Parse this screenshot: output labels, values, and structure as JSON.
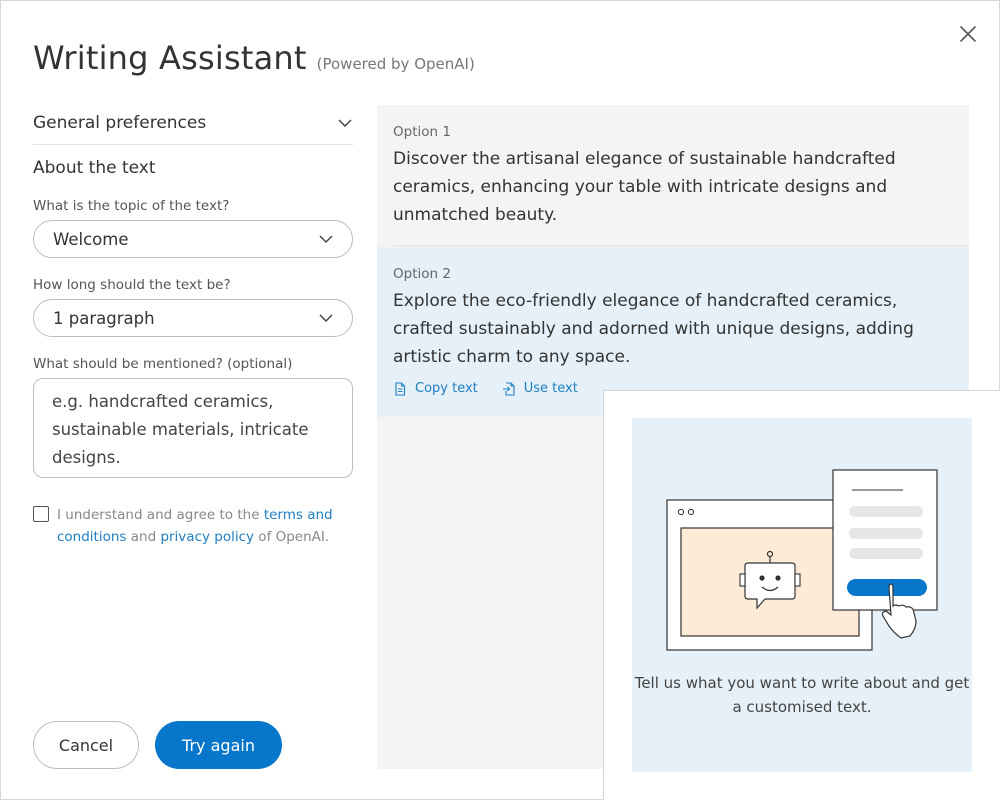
{
  "header": {
    "title": "Writing Assistant",
    "subtitle": "(Powered by OpenAI)"
  },
  "icons": {
    "close": "close-icon",
    "chevron": "chevron-down-icon",
    "copy": "copy-icon",
    "use": "use-text-icon"
  },
  "colors": {
    "accent": "#0877cb",
    "link": "#1e7fc1",
    "highlight": "#e5f0f8",
    "panel": "#f4f4f4"
  },
  "left": {
    "general_preferences": "General preferences",
    "about_title": "About the text",
    "topic_label": "What is the topic of the text?",
    "topic_value": "Welcome",
    "length_label": "How long should the text be?",
    "length_value": "1 paragraph",
    "mention_label": "What should be mentioned? (optional)",
    "mention_value": "e.g. handcrafted ceramics, sustainable materials, intricate designs.",
    "consent": {
      "checked": false,
      "prefix": "I understand and agree to the ",
      "terms": "terms and conditions",
      "middle": " and ",
      "privacy": "privacy policy",
      "suffix": " of OpenAI."
    }
  },
  "buttons": {
    "cancel": "Cancel",
    "try_again": "Try again"
  },
  "options": [
    {
      "label": "Option 1",
      "text": "Discover the artisanal elegance of sustainable handcrafted ceramics, enhancing your table with intricate designs and unmatched beauty."
    },
    {
      "label": "Option 2",
      "text": "Explore the eco-friendly elegance of handcrafted ceramics, crafted sustainably and adorned with unique designs, adding artistic charm to any space.",
      "copy_label": "Copy text",
      "use_label": "Use text"
    }
  ],
  "info_card": {
    "text": "Tell us what you want to write about and get a customised text."
  }
}
